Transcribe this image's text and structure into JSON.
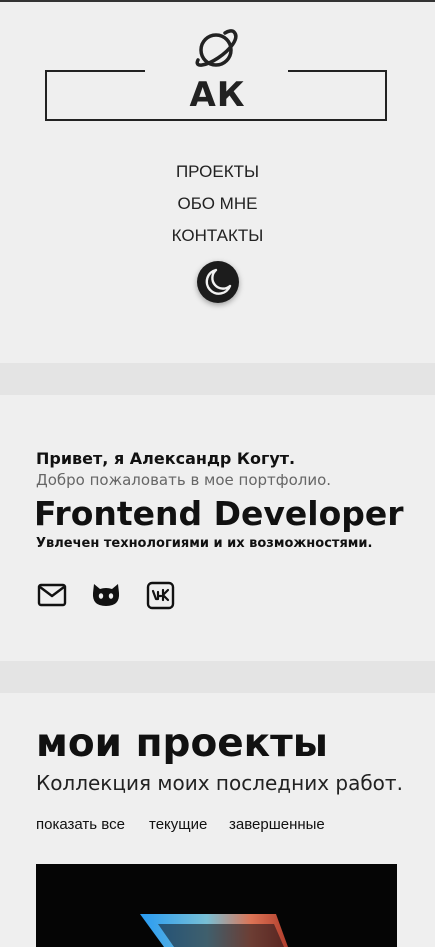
{
  "header": {
    "logo_text": "АК",
    "logo_icon": "planet-icon",
    "nav": [
      {
        "label": "ПРОЕКТЫ"
      },
      {
        "label": "ОБО МНЕ"
      },
      {
        "label": "КОНТАКТЫ"
      }
    ],
    "theme_toggle_icon": "moon-icon"
  },
  "hero": {
    "greeting": "Привет, я Александр Когут.",
    "welcome": "Добро пожаловать в мое портфолио.",
    "role": "Frontend Developer",
    "tagline": "Увлечен технологиями и их возможностями.",
    "social": [
      {
        "icon": "mail-icon"
      },
      {
        "icon": "github-icon"
      },
      {
        "icon": "vk-icon"
      }
    ]
  },
  "projects": {
    "title": "мои проекты",
    "subtitle": "Коллекция моих последних работ.",
    "filters": [
      {
        "label": "показать все"
      },
      {
        "label": "текущие"
      },
      {
        "label": "завершенные"
      }
    ]
  },
  "colors": {
    "background": "#efefef",
    "band": "#e4e4e4",
    "text": "#111111",
    "muted": "#666666",
    "theme_button": "#1c1c1c"
  }
}
